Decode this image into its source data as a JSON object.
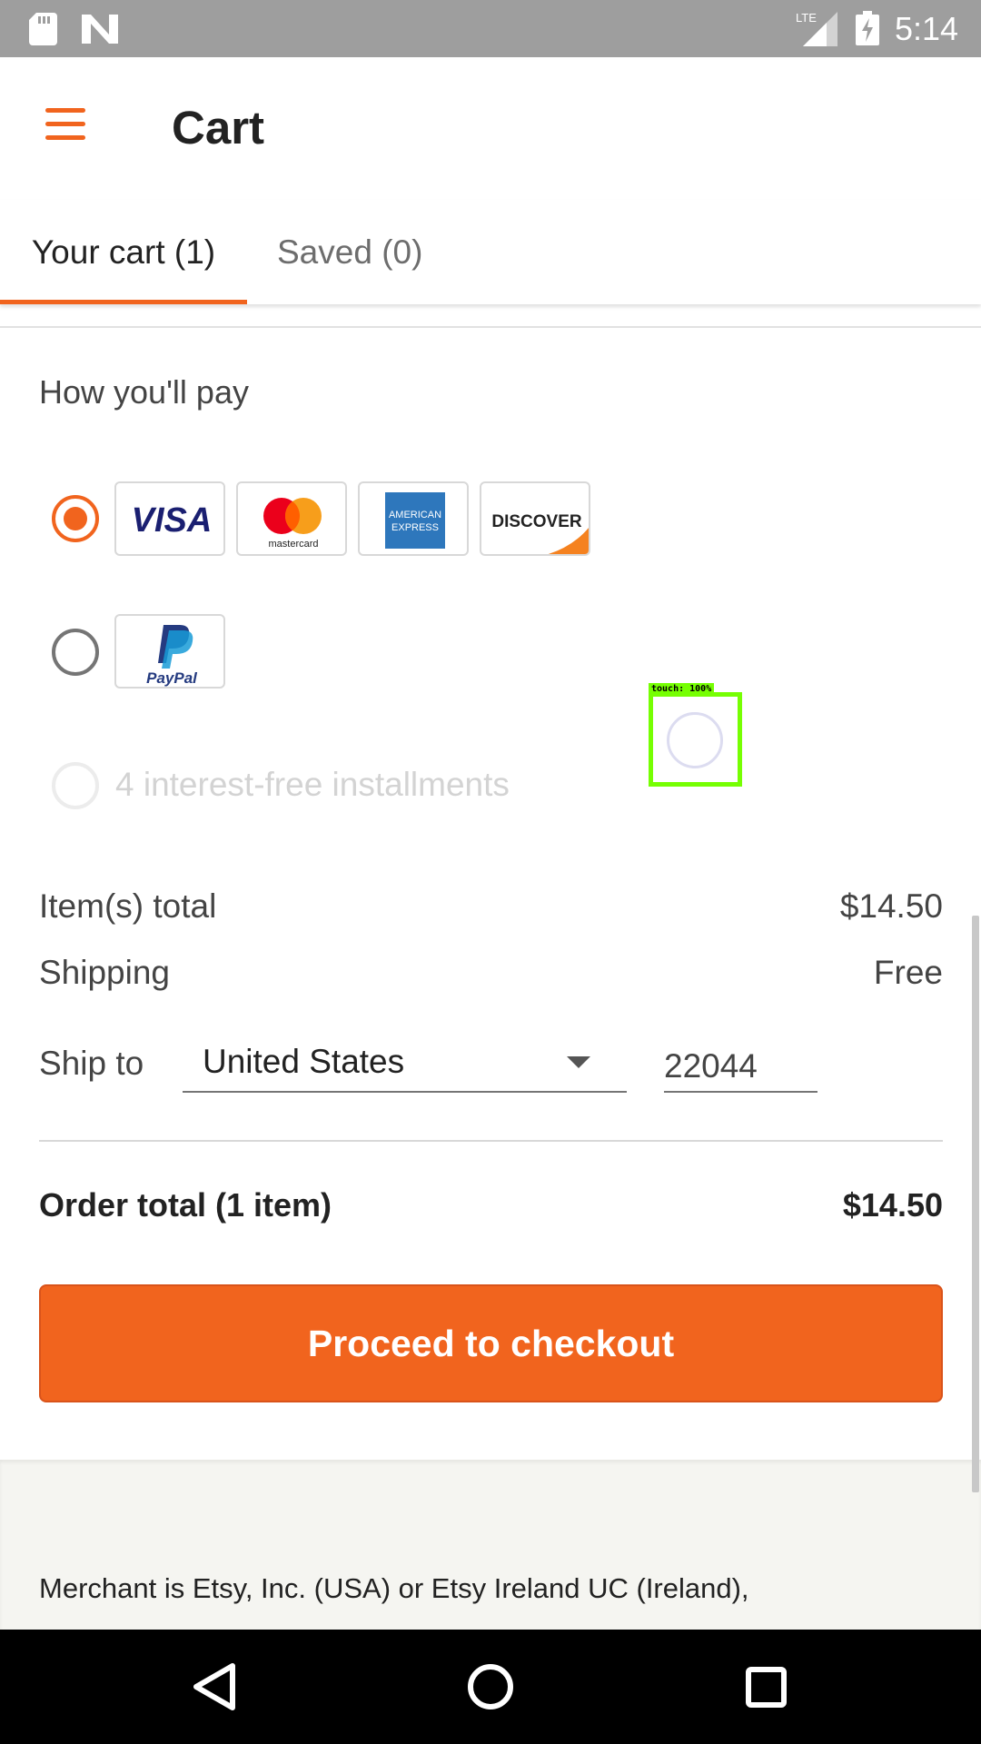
{
  "status_bar": {
    "time": "5:14",
    "network_label": "LTE",
    "icons": [
      "sd-card-icon",
      "n-logo-icon",
      "signal-lte-icon",
      "battery-charging-icon"
    ]
  },
  "app_bar": {
    "title": "Cart",
    "menu_icon": "hamburger-menu-icon"
  },
  "tabs": [
    {
      "label": "Your cart (1)",
      "active": true
    },
    {
      "label": "Saved (0)",
      "active": false
    }
  ],
  "payment": {
    "heading": "How you'll pay",
    "options": [
      {
        "id": "cards",
        "selected": true,
        "logos": [
          "Visa",
          "Mastercard",
          "American Express",
          "Discover"
        ]
      },
      {
        "id": "paypal",
        "selected": false,
        "logos": [
          "PayPal"
        ]
      },
      {
        "id": "installments",
        "selected": false,
        "disabled": true,
        "label": "4 interest-free installments"
      }
    ],
    "logo_text": {
      "visa": "VISA",
      "mastercard": "mastercard",
      "amex": [
        "AMERICAN",
        "EXPRESS"
      ],
      "discover": "DISCOVER",
      "paypal": "PayPal"
    }
  },
  "touch_indicator": {
    "label": "touch: 100%"
  },
  "summary": {
    "items_total_label": "Item(s) total",
    "items_total_value": "$14.50",
    "shipping_label": "Shipping",
    "shipping_value": "Free",
    "ship_to_label": "Ship to",
    "country": "United States",
    "zip": "22044",
    "order_total_label": "Order total (1 item)",
    "order_total_value": "$14.50"
  },
  "checkout_button": "Proceed to checkout",
  "footer": {
    "merchant_text": "Merchant is Etsy, Inc. (USA) or Etsy Ireland UC (Ireland),"
  },
  "colors": {
    "accent": "#f1641e",
    "status_bar": "#9e9e9e",
    "nav_bar": "#000000"
  },
  "nav_bar": {
    "buttons": [
      "back-icon",
      "home-icon",
      "recents-icon"
    ]
  }
}
